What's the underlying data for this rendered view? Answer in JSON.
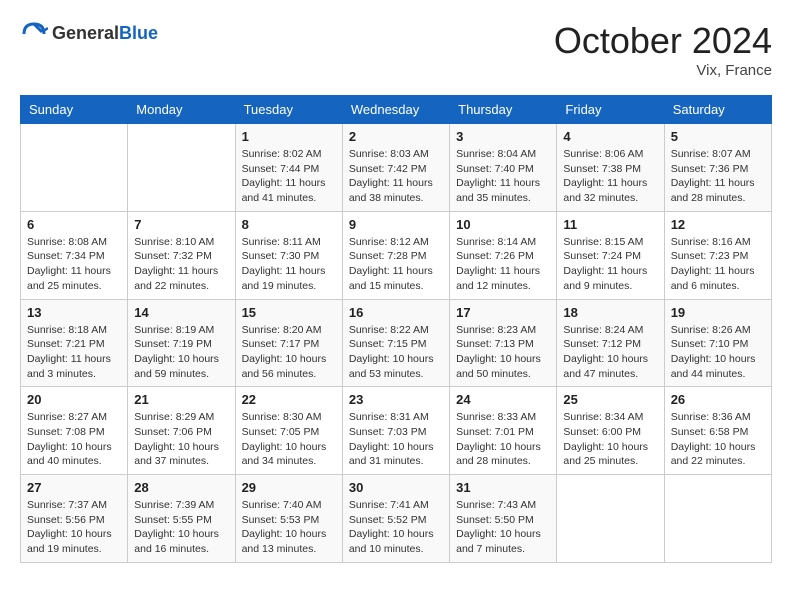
{
  "header": {
    "logo_line1": "General",
    "logo_line2": "Blue",
    "month": "October 2024",
    "location": "Vix, France"
  },
  "weekdays": [
    "Sunday",
    "Monday",
    "Tuesday",
    "Wednesday",
    "Thursday",
    "Friday",
    "Saturday"
  ],
  "weeks": [
    [
      {
        "day": null
      },
      {
        "day": null
      },
      {
        "day": "1",
        "sunrise": "Sunrise: 8:02 AM",
        "sunset": "Sunset: 7:44 PM",
        "daylight": "Daylight: 11 hours and 41 minutes."
      },
      {
        "day": "2",
        "sunrise": "Sunrise: 8:03 AM",
        "sunset": "Sunset: 7:42 PM",
        "daylight": "Daylight: 11 hours and 38 minutes."
      },
      {
        "day": "3",
        "sunrise": "Sunrise: 8:04 AM",
        "sunset": "Sunset: 7:40 PM",
        "daylight": "Daylight: 11 hours and 35 minutes."
      },
      {
        "day": "4",
        "sunrise": "Sunrise: 8:06 AM",
        "sunset": "Sunset: 7:38 PM",
        "daylight": "Daylight: 11 hours and 32 minutes."
      },
      {
        "day": "5",
        "sunrise": "Sunrise: 8:07 AM",
        "sunset": "Sunset: 7:36 PM",
        "daylight": "Daylight: 11 hours and 28 minutes."
      }
    ],
    [
      {
        "day": "6",
        "sunrise": "Sunrise: 8:08 AM",
        "sunset": "Sunset: 7:34 PM",
        "daylight": "Daylight: 11 hours and 25 minutes."
      },
      {
        "day": "7",
        "sunrise": "Sunrise: 8:10 AM",
        "sunset": "Sunset: 7:32 PM",
        "daylight": "Daylight: 11 hours and 22 minutes."
      },
      {
        "day": "8",
        "sunrise": "Sunrise: 8:11 AM",
        "sunset": "Sunset: 7:30 PM",
        "daylight": "Daylight: 11 hours and 19 minutes."
      },
      {
        "day": "9",
        "sunrise": "Sunrise: 8:12 AM",
        "sunset": "Sunset: 7:28 PM",
        "daylight": "Daylight: 11 hours and 15 minutes."
      },
      {
        "day": "10",
        "sunrise": "Sunrise: 8:14 AM",
        "sunset": "Sunset: 7:26 PM",
        "daylight": "Daylight: 11 hours and 12 minutes."
      },
      {
        "day": "11",
        "sunrise": "Sunrise: 8:15 AM",
        "sunset": "Sunset: 7:24 PM",
        "daylight": "Daylight: 11 hours and 9 minutes."
      },
      {
        "day": "12",
        "sunrise": "Sunrise: 8:16 AM",
        "sunset": "Sunset: 7:23 PM",
        "daylight": "Daylight: 11 hours and 6 minutes."
      }
    ],
    [
      {
        "day": "13",
        "sunrise": "Sunrise: 8:18 AM",
        "sunset": "Sunset: 7:21 PM",
        "daylight": "Daylight: 11 hours and 3 minutes."
      },
      {
        "day": "14",
        "sunrise": "Sunrise: 8:19 AM",
        "sunset": "Sunset: 7:19 PM",
        "daylight": "Daylight: 10 hours and 59 minutes."
      },
      {
        "day": "15",
        "sunrise": "Sunrise: 8:20 AM",
        "sunset": "Sunset: 7:17 PM",
        "daylight": "Daylight: 10 hours and 56 minutes."
      },
      {
        "day": "16",
        "sunrise": "Sunrise: 8:22 AM",
        "sunset": "Sunset: 7:15 PM",
        "daylight": "Daylight: 10 hours and 53 minutes."
      },
      {
        "day": "17",
        "sunrise": "Sunrise: 8:23 AM",
        "sunset": "Sunset: 7:13 PM",
        "daylight": "Daylight: 10 hours and 50 minutes."
      },
      {
        "day": "18",
        "sunrise": "Sunrise: 8:24 AM",
        "sunset": "Sunset: 7:12 PM",
        "daylight": "Daylight: 10 hours and 47 minutes."
      },
      {
        "day": "19",
        "sunrise": "Sunrise: 8:26 AM",
        "sunset": "Sunset: 7:10 PM",
        "daylight": "Daylight: 10 hours and 44 minutes."
      }
    ],
    [
      {
        "day": "20",
        "sunrise": "Sunrise: 8:27 AM",
        "sunset": "Sunset: 7:08 PM",
        "daylight": "Daylight: 10 hours and 40 minutes."
      },
      {
        "day": "21",
        "sunrise": "Sunrise: 8:29 AM",
        "sunset": "Sunset: 7:06 PM",
        "daylight": "Daylight: 10 hours and 37 minutes."
      },
      {
        "day": "22",
        "sunrise": "Sunrise: 8:30 AM",
        "sunset": "Sunset: 7:05 PM",
        "daylight": "Daylight: 10 hours and 34 minutes."
      },
      {
        "day": "23",
        "sunrise": "Sunrise: 8:31 AM",
        "sunset": "Sunset: 7:03 PM",
        "daylight": "Daylight: 10 hours and 31 minutes."
      },
      {
        "day": "24",
        "sunrise": "Sunrise: 8:33 AM",
        "sunset": "Sunset: 7:01 PM",
        "daylight": "Daylight: 10 hours and 28 minutes."
      },
      {
        "day": "25",
        "sunrise": "Sunrise: 8:34 AM",
        "sunset": "Sunset: 6:00 PM",
        "daylight": "Daylight: 10 hours and 25 minutes."
      },
      {
        "day": "26",
        "sunrise": "Sunrise: 8:36 AM",
        "sunset": "Sunset: 6:58 PM",
        "daylight": "Daylight: 10 hours and 22 minutes."
      }
    ],
    [
      {
        "day": "27",
        "sunrise": "Sunrise: 7:37 AM",
        "sunset": "Sunset: 5:56 PM",
        "daylight": "Daylight: 10 hours and 19 minutes."
      },
      {
        "day": "28",
        "sunrise": "Sunrise: 7:39 AM",
        "sunset": "Sunset: 5:55 PM",
        "daylight": "Daylight: 10 hours and 16 minutes."
      },
      {
        "day": "29",
        "sunrise": "Sunrise: 7:40 AM",
        "sunset": "Sunset: 5:53 PM",
        "daylight": "Daylight: 10 hours and 13 minutes."
      },
      {
        "day": "30",
        "sunrise": "Sunrise: 7:41 AM",
        "sunset": "Sunset: 5:52 PM",
        "daylight": "Daylight: 10 hours and 10 minutes."
      },
      {
        "day": "31",
        "sunrise": "Sunrise: 7:43 AM",
        "sunset": "Sunset: 5:50 PM",
        "daylight": "Daylight: 10 hours and 7 minutes."
      },
      {
        "day": null
      },
      {
        "day": null
      }
    ]
  ]
}
